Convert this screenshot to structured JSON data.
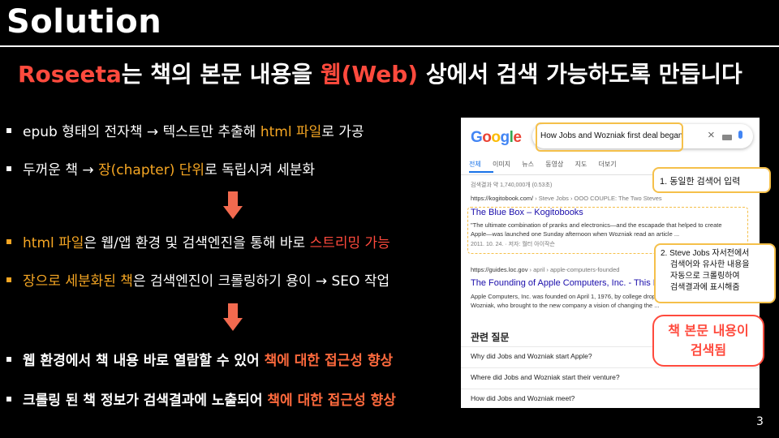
{
  "title": "Solution",
  "subtitle": {
    "brand": "Roseeta",
    "part1": "는 책의 본문 내용을 ",
    "web": "웹(Web)",
    "part2": " 상에서 검색 가능하도록 만듭니다"
  },
  "bullets": [
    {
      "a": "epub 형태의 전자책  → 텍스트만 추출해 ",
      "h": "html 파일",
      "b": "로 가공"
    },
    {
      "a": "두꺼운 책 → ",
      "h": "장(chapter) 단위",
      "b": "로 독립시켜 세분화"
    },
    {
      "h": "html 파일",
      "a": "은 웹/앱 환경 및 검색엔진을 통해 바로 ",
      "r": "스트리밍 가능"
    },
    {
      "h": "장으로 세분화된 책",
      "a": "은 검색엔진이  크롤링하기 용이 → SEO 작업"
    },
    {
      "a": "웹 환경에서 책 내용 바로 열람할 수 있어 ",
      "h": "책에 대한 접근성 향상"
    },
    {
      "a": "크롤링 된 책 정보가 검색결과에 노출되어 ",
      "h": "책에 대한 접근성 향상"
    }
  ],
  "search": {
    "logo": "Google",
    "query": "How Jobs and Wozniak first deal began",
    "clear_icon": "×",
    "tabs": [
      "전체",
      "이미지",
      "뉴스",
      "동영상",
      "지도",
      "더보기"
    ],
    "stats": "검색결과 약 1,740,000개 (0.53초)",
    "result1": {
      "url": "https://kogitobook.com/",
      "crumb": " › Steve Jobs › OOO COUPLE: The Two Steves",
      "title": "The Blue Box – Kogitobooks",
      "snippet1": "\"The ultimate combination of pranks and electronics—and the escapade that helped to create",
      "snippet2": "Apple—was launched one Sunday afternoon when Wozniak read an article ...",
      "meta": "2011. 10. 24. · 저자: 월터 아이작슨"
    },
    "result2": {
      "url": "https://guides.loc.gov",
      "crumb": " › april › apple-computers-founded",
      "title": "The Founding of Apple Computers, Inc. - This M",
      "snippet1": "Apple Computers, Inc. was founded on April 1, 1976, by college dropo",
      "snippet2": "Wozniak, who brought to the new company a vision of changing the ..."
    },
    "related_title": "관련 질문",
    "questions": [
      "Why did Jobs and Wozniak start Apple?",
      "Where did Jobs and Wozniak start their venture?",
      "How did Jobs and Wozniak meet?"
    ]
  },
  "callouts": {
    "c1": "1. 동일한 검색어 입력",
    "c2_line1": "2. Steve Jobs 자서전에서",
    "c2_line2": "검색어와 유사한 내용을",
    "c2_line3": "자동으로 크롤링하여",
    "c2_line4": "검색결과에 표시해줌",
    "note_line1": "책 본문 내용이",
    "note_line2": "검색됨"
  },
  "page_number": "3",
  "colors": {
    "accent_red": "#ff4a3d",
    "accent_orange": "#f5a623",
    "highlight": "#f5c04a",
    "link": "#1a0dab"
  },
  "icons": [
    "right-arrow-icon",
    "down-arrow-icon",
    "search-icon",
    "clear-icon",
    "keyboard-icon",
    "mic-icon"
  ]
}
